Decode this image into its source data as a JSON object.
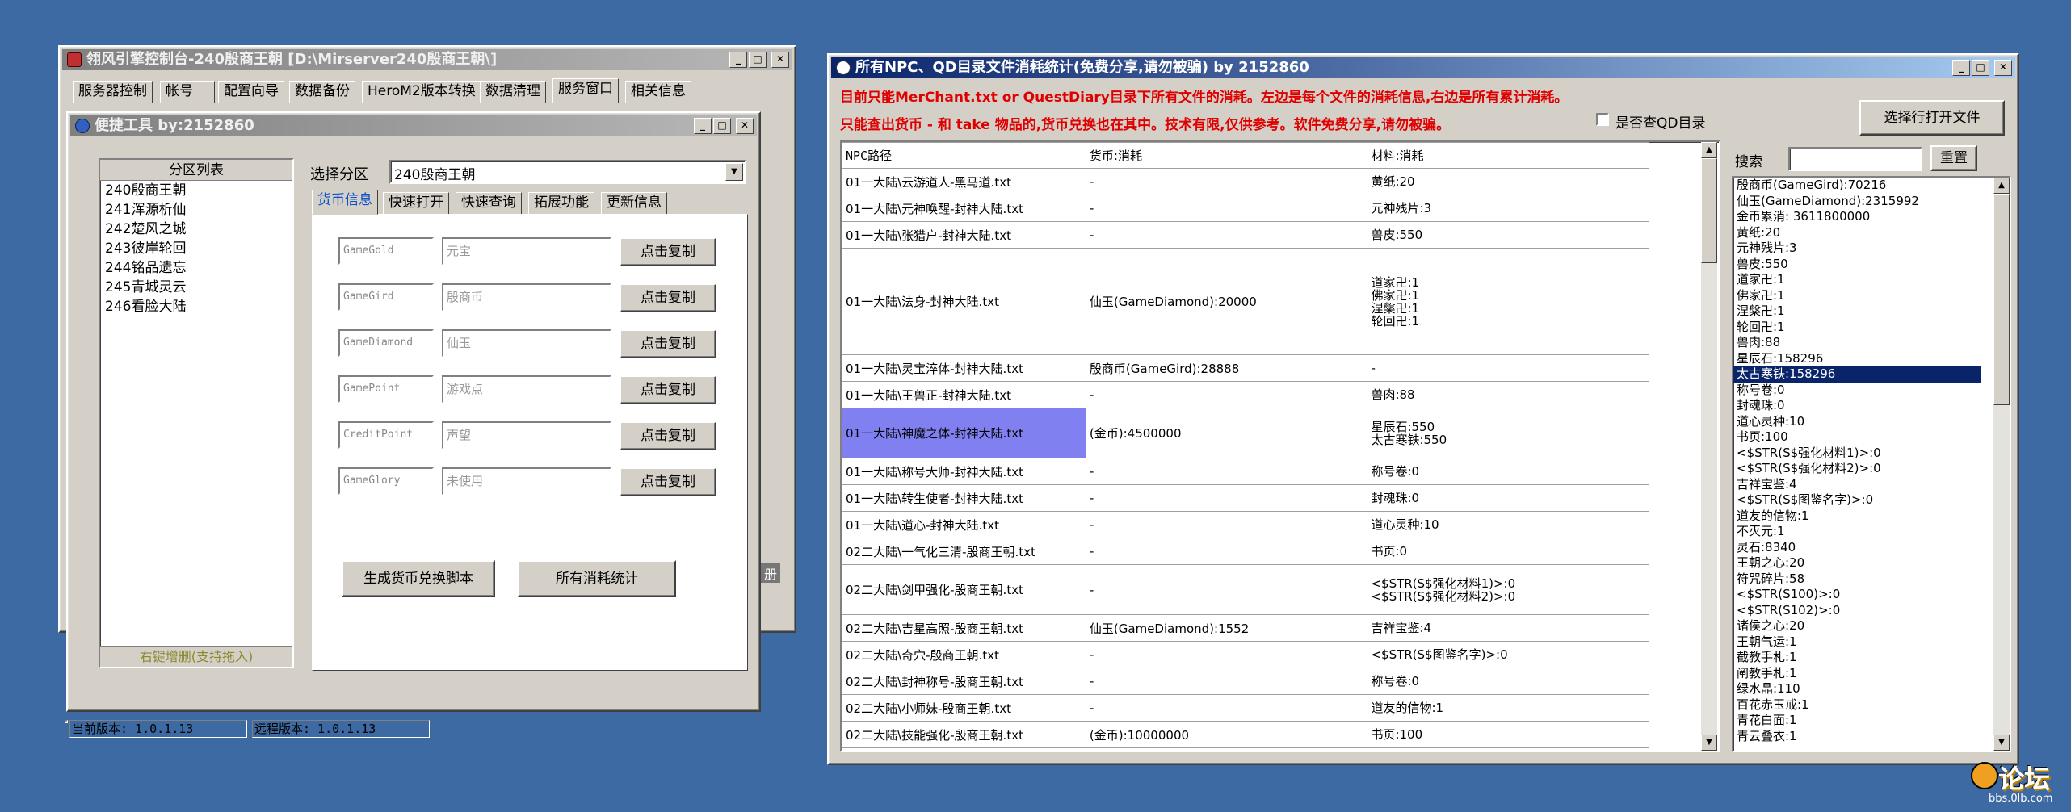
{
  "win1": {
    "title": "翎风引擎控制台-240殷商王朝 [D:\\Mirserver240殷商王朝\\]",
    "tabs": [
      "服务器控制",
      "帐号",
      "配置向导",
      "数据备份",
      "HeroM2版本转换",
      "数据清理",
      "服务窗口",
      "相关信息"
    ],
    "status": {
      "current": "当前版本: 1.0.1.13",
      "remote": "远程版本: 1.0.1.13"
    },
    "hidden_text": "册"
  },
  "win2": {
    "title": "便捷工具   by:2152860",
    "list_title": "分区列表",
    "list_items": [
      "240殷商王朝",
      "241浑源析仙",
      "242楚风之城",
      "243彼岸轮回",
      "244铭品遗忘",
      "245青城灵云",
      "246看脸大陆"
    ],
    "list_footer": "右键增删(支持拖入)",
    "select_label": "选择分区",
    "select_value": "240殷商王朝",
    "tabs": [
      "货币信息",
      "快速打开",
      "快速查询",
      "拓展功能",
      "更新信息"
    ],
    "rows": [
      {
        "code": "GameGold",
        "name": "元宝",
        "button": "点击复制"
      },
      {
        "code": "GameGird",
        "name": "殷商币",
        "button": "点击复制"
      },
      {
        "code": "GameDiamond",
        "name": "仙玉",
        "button": "点击复制"
      },
      {
        "code": "GamePoint",
        "name": "游戏点",
        "button": "点击复制"
      },
      {
        "code": "CreditPoint",
        "name": "声望",
        "button": "点击复制"
      },
      {
        "code": "GameGlory",
        "name": "未使用",
        "button": "点击复制"
      }
    ],
    "gen_button": "生成货币兑换脚本",
    "stats_button": "所有消耗统计"
  },
  "win3": {
    "title": "所有NPC、QD目录文件消耗统计(免费分享,请勿被骗)      by 2152860",
    "notice1": "目前只能MerChant.txt or QuestDiary目录下所有文件的消耗。左边是每个文件的消耗信息,右边是所有累计消耗。",
    "notice2": "只能查出货币 - 和 take 物品的,货币兑换也在其中。技术有限,仅供参考。软件免费分享,请勿被骗。",
    "checkbox_label": "是否查QD目录",
    "open_button": "选择行打开文件",
    "search_label": "搜索",
    "reset_button": "重置",
    "table": {
      "headers": [
        "NPC路径",
        "货币:消耗",
        "材料:消耗"
      ],
      "rows": [
        {
          "path": "01一大陆\\云游道人-黑马道.txt",
          "currency": "-",
          "material": "黄纸:20"
        },
        {
          "path": "01一大陆\\元神唤醒-封神大陆.txt",
          "currency": "-",
          "material": "元神残片:3"
        },
        {
          "path": "01一大陆\\张猎户-封神大陆.txt",
          "currency": "-",
          "material": "兽皮:550"
        },
        {
          "path": "01一大陆\\法身-封神大陆.txt",
          "currency": "仙玉(GameDiamond):20000",
          "material": "道家卍:1\n佛家卍:1\n涅槃卍:1\n轮回卍:1"
        },
        {
          "path": "01一大陆\\灵宝淬体-封神大陆.txt",
          "currency": "殷商币(GameGird):28888",
          "material": "-"
        },
        {
          "path": "01一大陆\\王兽正-封神大陆.txt",
          "currency": "-",
          "material": "兽肉:88"
        },
        {
          "path": "01一大陆\\神魔之体-封神大陆.txt",
          "currency": "(金币):4500000",
          "material": "星辰石:550\n太古寒铁:550"
        },
        {
          "path": "01一大陆\\称号大师-封神大陆.txt",
          "currency": "-",
          "material": "称号卷:0"
        },
        {
          "path": "01一大陆\\转生使者-封神大陆.txt",
          "currency": "-",
          "material": "封魂珠:0"
        },
        {
          "path": "01一大陆\\道心-封神大陆.txt",
          "currency": "-",
          "material": "道心灵种:10"
        },
        {
          "path": "02二大陆\\一气化三清-殷商王朝.txt",
          "currency": "-",
          "material": "书页:0"
        },
        {
          "path": "02二大陆\\剑甲强化-殷商王朝.txt",
          "currency": "-",
          "material": "<$STR(S$强化材料1)>:0\n<$STR(S$强化材料2)>:0"
        },
        {
          "path": "02二大陆\\吉星高照-殷商王朝.txt",
          "currency": "仙玉(GameDiamond):1552",
          "material": "吉祥宝鉴:4"
        },
        {
          "path": "02二大陆\\奇穴-殷商王朝.txt",
          "currency": "-",
          "material": "<$STR(S$图鉴名字)>:0"
        },
        {
          "path": "02二大陆\\封神称号-殷商王朝.txt",
          "currency": "-",
          "material": "称号卷:0"
        },
        {
          "path": "02二大陆\\小师妹-殷商王朝.txt",
          "currency": "-",
          "material": "道友的信物:1"
        },
        {
          "path": "02二大陆\\技能强化-殷商王朝.txt",
          "currency": "(金币):10000000",
          "material": "书页:100"
        }
      ]
    },
    "totals": [
      "殷商币(GameGird):70216",
      "仙玉(GameDiamond):2315992",
      "金币累消: 3611800000",
      "黄纸:20",
      "元神残片:3",
      "兽皮:550",
      "道家卍:1",
      "佛家卍:1",
      "涅槃卍:1",
      "轮回卍:1",
      "兽肉:88",
      "星辰石:158296",
      "太古寒铁:158296",
      "称号卷:0",
      "封魂珠:0",
      "道心灵种:10",
      "书页:100",
      "<$STR(S$强化材料1)>:0",
      "<$STR(S$强化材料2)>:0",
      "吉祥宝鉴:4",
      "<$STR(S$图鉴名字)>:0",
      "道友的信物:1",
      "不灭元:1",
      "灵石:8340",
      "王朝之心:20",
      "符咒碎片:58",
      "<$STR(S100)>:0",
      "<$STR(S102)>:0",
      "诸侯之心:20",
      "王朝气运:1",
      "截教手札:1",
      "阐教手札:1",
      "绿水晶:110",
      "百花赤玉戒:1",
      "青花白面:1",
      "青云叠衣:1"
    ],
    "selected_total_index": 12
  },
  "watermark": {
    "text": "论坛",
    "sub": "bbs.0lb.com"
  }
}
